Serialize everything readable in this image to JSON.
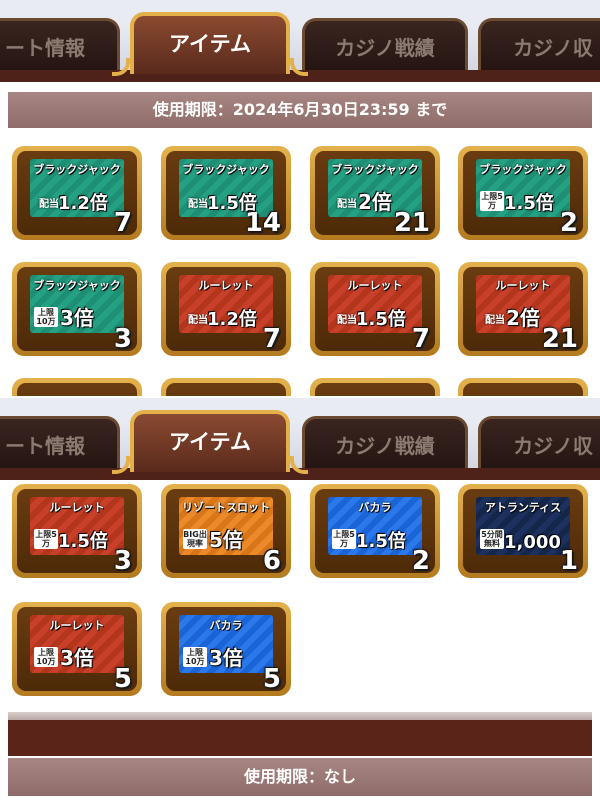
{
  "tabs": [
    "ート情報",
    "アイテム",
    "カジノ戦績",
    "カジノ収"
  ],
  "expiry_top": "使用期限：2024年6月30日23:59 まで",
  "expiry_bottom": "使用期限：なし",
  "items_top": [
    {
      "title": "ブラックジャック",
      "sub": "配当",
      "value": "1.2倍",
      "count": "7",
      "color": "green"
    },
    {
      "title": "ブラックジャック",
      "sub": "配当",
      "value": "1.5倍",
      "count": "14",
      "color": "green"
    },
    {
      "title": "ブラックジャック",
      "sub": "配当",
      "value": "2倍",
      "count": "21",
      "color": "green"
    },
    {
      "title": "ブラックジャック",
      "sub": "上限5万",
      "value": "1.5倍",
      "count": "2",
      "color": "green"
    },
    {
      "title": "ブラックジャック",
      "sub": "上限10万",
      "value": "3倍",
      "count": "3",
      "color": "green"
    },
    {
      "title": "ルーレット",
      "sub": "配当",
      "value": "1.2倍",
      "count": "7",
      "color": "red"
    },
    {
      "title": "ルーレット",
      "sub": "配当",
      "value": "1.5倍",
      "count": "7",
      "color": "red"
    },
    {
      "title": "ルーレット",
      "sub": "配当",
      "value": "2倍",
      "count": "21",
      "color": "red"
    }
  ],
  "items_bottom": [
    {
      "title": "ルーレット",
      "sub": "上限5万",
      "value": "1.5倍",
      "count": "3",
      "color": "red"
    },
    {
      "title": "リゾートスロット",
      "sub": "BIG出現率",
      "value": "5倍",
      "count": "6",
      "color": "orange"
    },
    {
      "title": "バカラ",
      "sub": "上限5万",
      "value": "1.5倍",
      "count": "2",
      "color": "blue"
    },
    {
      "title": "アトランティス",
      "sub": "5分間無料",
      "value": "1,000",
      "count": "1",
      "color": "navy"
    },
    {
      "title": "ルーレット",
      "sub": "上限10万",
      "value": "3倍",
      "count": "5",
      "color": "red"
    },
    {
      "title": "バカラ",
      "sub": "上限10万",
      "value": "3倍",
      "count": "5",
      "color": "blue"
    }
  ],
  "colors": {
    "accent_gold": "#e3b04a",
    "tab_active": "#7a3a26",
    "banner": "#9c7b78"
  }
}
